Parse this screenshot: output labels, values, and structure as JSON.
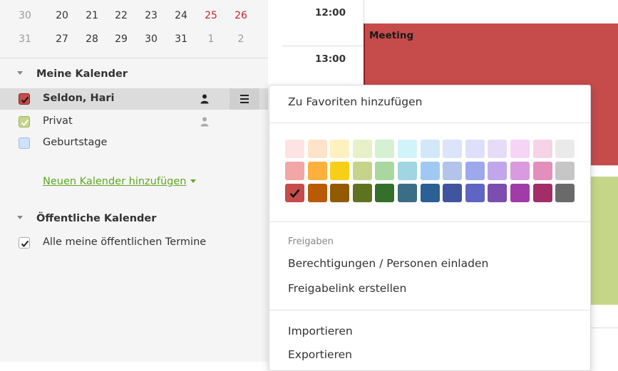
{
  "mini_calendar": {
    "rows": [
      {
        "week": "30",
        "days": [
          "20",
          "21",
          "22",
          "23",
          "24",
          "25",
          "26"
        ]
      },
      {
        "week": "31",
        "days": [
          "27",
          "28",
          "29",
          "30",
          "31",
          "1",
          "2"
        ]
      }
    ]
  },
  "sidebar": {
    "my_calendars_title": "Meine Kalender",
    "folders": [
      {
        "label": "Seldon, Hari",
        "color": "#c64b4b",
        "checked": true,
        "selected": true
      },
      {
        "label": "Privat",
        "color": "#c6d688",
        "checked": true,
        "selected": false
      },
      {
        "label": "Geburtstage",
        "color": "#cfe2fb",
        "checked": false,
        "selected": false
      }
    ],
    "add_calendar_link": "Neuen Kalender hinzufügen",
    "public_calendars_title": "Öffentliche Kalender",
    "public_all_label": "Alle meine öffentlichen Termine"
  },
  "calendar": {
    "times": [
      "12:00",
      "13:00"
    ],
    "event_title": "Meeting"
  },
  "context_menu": {
    "favorites": "Zu Favoriten hinzufügen",
    "color_rows": [
      [
        "#fde3e3",
        "#fde3c8",
        "#fdf1c0",
        "#e8f0c7",
        "#d5f0d3",
        "#d1f3fa",
        "#d3e7fb",
        "#dbe4f8",
        "#dde0f8",
        "#e7dcf8",
        "#f5d4f5",
        "#f6d3e6",
        "#eaeaea"
      ],
      [
        "#f2a6a6",
        "#fcb13f",
        "#f8cf18",
        "#c5d48a",
        "#a8d8a0",
        "#9fd6e2",
        "#9fc9f3",
        "#b3c3ec",
        "#9ea8ec",
        "#c1a6ec",
        "#d99ae0",
        "#e28fbd",
        "#c6c6c6"
      ],
      [
        "#c64b4b",
        "#b85a06",
        "#935a00",
        "#5e7320",
        "#356f2c",
        "#3b6e86",
        "#2a6094",
        "#4054a0",
        "#5e65c2",
        "#7b4eb0",
        "#a13ba8",
        "#a32d68",
        "#6a6a6a"
      ]
    ],
    "selected_color": "#c64b4b",
    "sharing_header": "Freigaben",
    "permissions": "Berechtigungen / Personen einladen",
    "share_link": "Freigabelink erstellen",
    "import": "Importieren",
    "export": "Exportieren"
  }
}
